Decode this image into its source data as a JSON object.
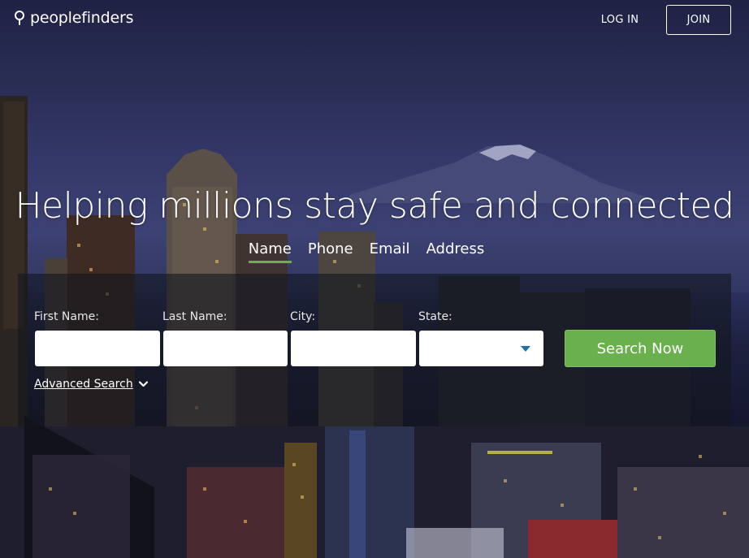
{
  "header": {
    "logo_text": "peoplefinders",
    "logo_icon": "location-pin-icon",
    "login_label": "LOG IN",
    "join_label": "JOIN"
  },
  "hero": {
    "headline": "Helping millions stay safe and connected"
  },
  "tabs": [
    {
      "label": "Name",
      "active": true
    },
    {
      "label": "Phone",
      "active": false
    },
    {
      "label": "Email",
      "active": false
    },
    {
      "label": "Address",
      "active": false
    }
  ],
  "search": {
    "first_name_label": "First Name:",
    "first_name_value": "",
    "last_name_label": "Last Name:",
    "last_name_value": "",
    "city_label": "City:",
    "city_value": "",
    "state_label": "State:",
    "state_value": "",
    "submit_label": "Search Now",
    "advanced_label": "Advanced Search",
    "advanced_icon": "chevron-down-icon"
  },
  "colors": {
    "accent_green": "#6ab04c",
    "caret_blue": "#1f6fa8"
  }
}
